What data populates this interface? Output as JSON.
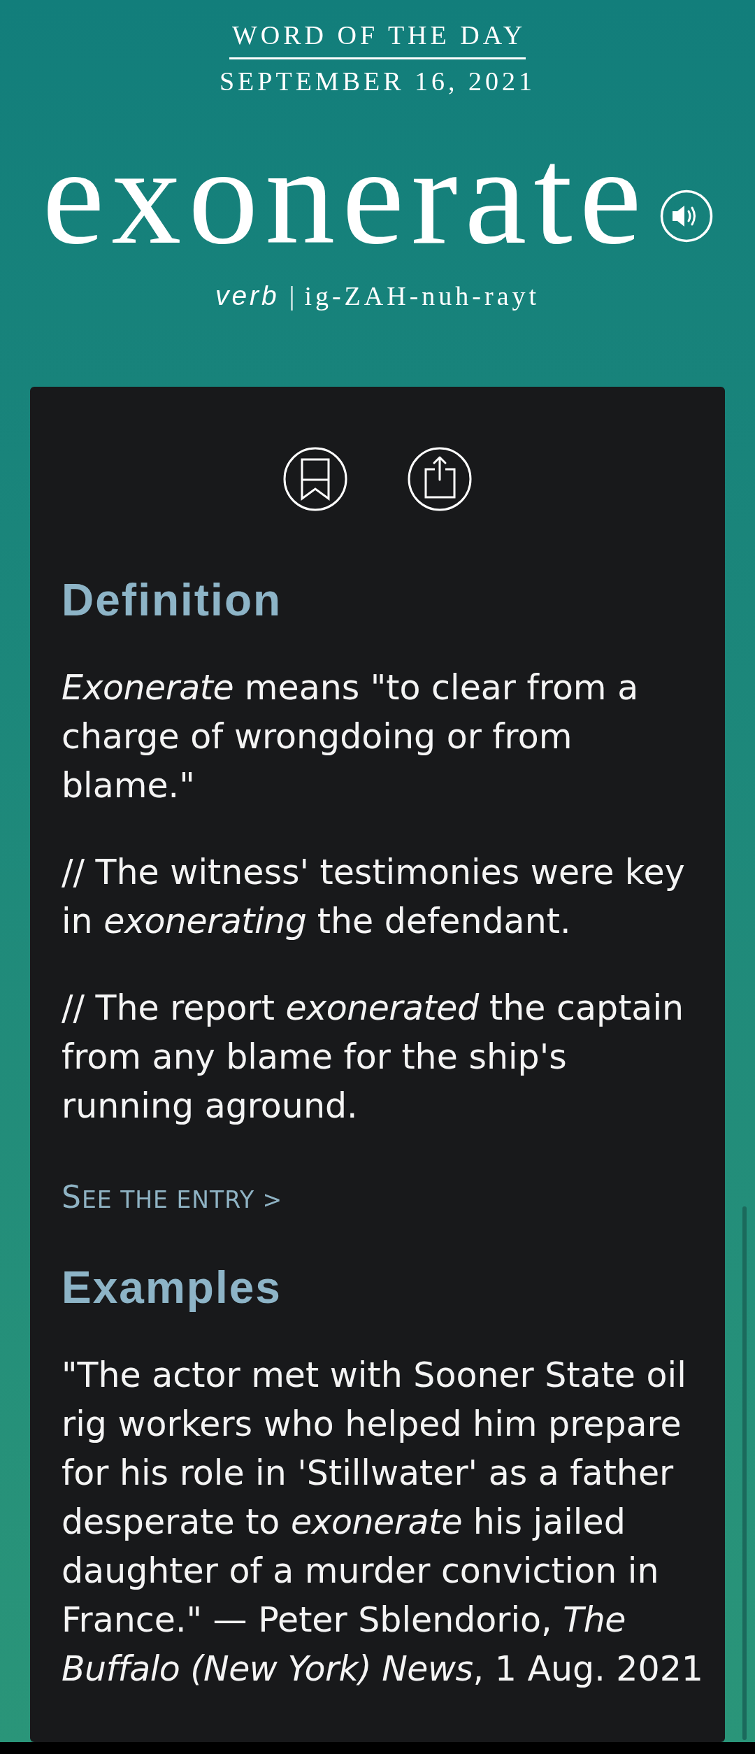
{
  "header": {
    "kicker": "WORD OF THE DAY",
    "date": "SEPTEMBER 16, 2021"
  },
  "word": {
    "text": "exonerate",
    "part_of_speech": "verb",
    "separator": "|",
    "pronunciation": "ig-ZAH-nuh-rayt"
  },
  "card": {
    "sections": [
      {
        "heading": "Definition",
        "paragraphs": [
          "*Exonerate* means \"to clear from a charge of wrongdoing or from blame.\"",
          "// The witness' testimonies were key in *exonerating* the defendant.",
          "// The report *exonerated* the captain from any blame for the ship's running aground."
        ],
        "link": "SEE THE ENTRY >"
      },
      {
        "heading": "Examples",
        "paragraphs": [
          "\"The actor met with Sooner State oil rig workers who helped him prepare for his role in 'Stillwater' as a father desperate to *exonerate* his jailed daughter of a murder conviction in France.\" — Peter Sblendorio, *The Buffalo (New York) News*, 1 Aug. 2021"
        ]
      }
    ]
  }
}
